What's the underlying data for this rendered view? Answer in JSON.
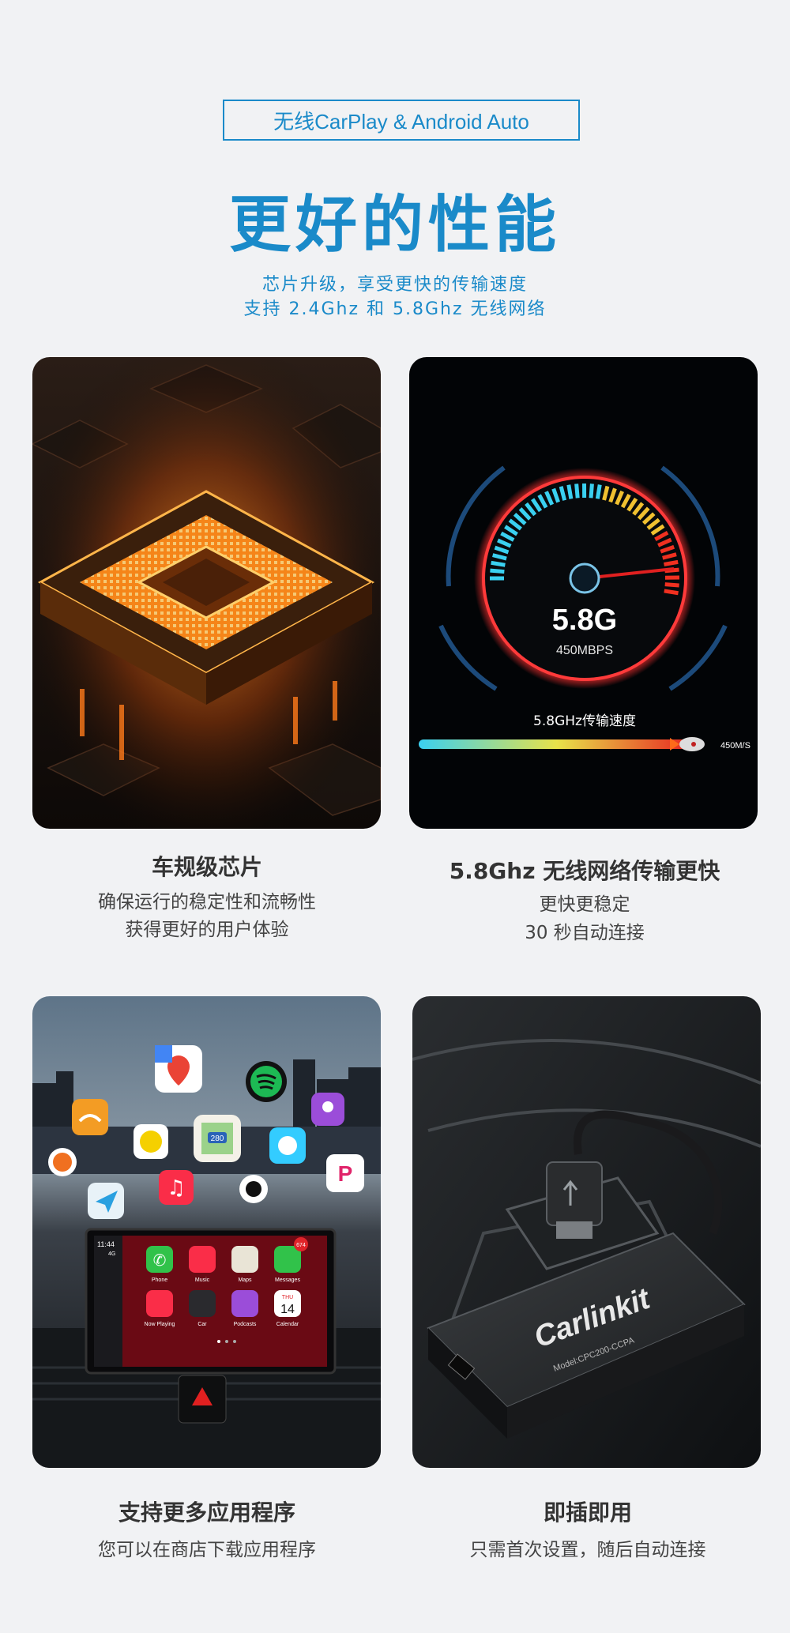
{
  "header": {
    "tag": "无线CarPlay & Android Auto",
    "title": "更好的性能",
    "subtitle_line1": "芯片升级，享受更快的传输速度",
    "subtitle_line2": "支持 2.4Ghz 和 5.8Ghz 无线网络"
  },
  "features": [
    {
      "title": "车规级芯片",
      "lines": [
        "确保运行的稳定性和流畅性",
        "获得更好的用户体验"
      ]
    },
    {
      "title": "5.8Ghz 无线网络传输更快",
      "lines": [
        "更快更稳定",
        "30 秒自动连接"
      ],
      "gauge": {
        "value": "5.8G",
        "unit": "450MBPS",
        "bar_label": "5.8GHz传输速度",
        "bar_end": "450M/S"
      }
    },
    {
      "title": "支持更多应用程序",
      "lines": [
        "您可以在商店下载应用程序"
      ],
      "screen": {
        "time": "11:44",
        "signal": "4G",
        "badge": "674",
        "calendar_day": "THU",
        "calendar_date": "14",
        "apps": [
          "Phone",
          "Music",
          "Maps",
          "Messages",
          "Now Playing",
          "Car",
          "Podcasts",
          "Calendar"
        ],
        "road_sign": "280"
      }
    },
    {
      "title": "即插即用",
      "lines": [
        "只需首次设置，随后自动连接"
      ],
      "device": {
        "brand": "Carlinkit",
        "model": "Model:CPC200-CCPA"
      }
    }
  ],
  "colors": {
    "accent": "#1a8ac9",
    "page_bg": "#f1f2f4",
    "text": "#333333"
  }
}
